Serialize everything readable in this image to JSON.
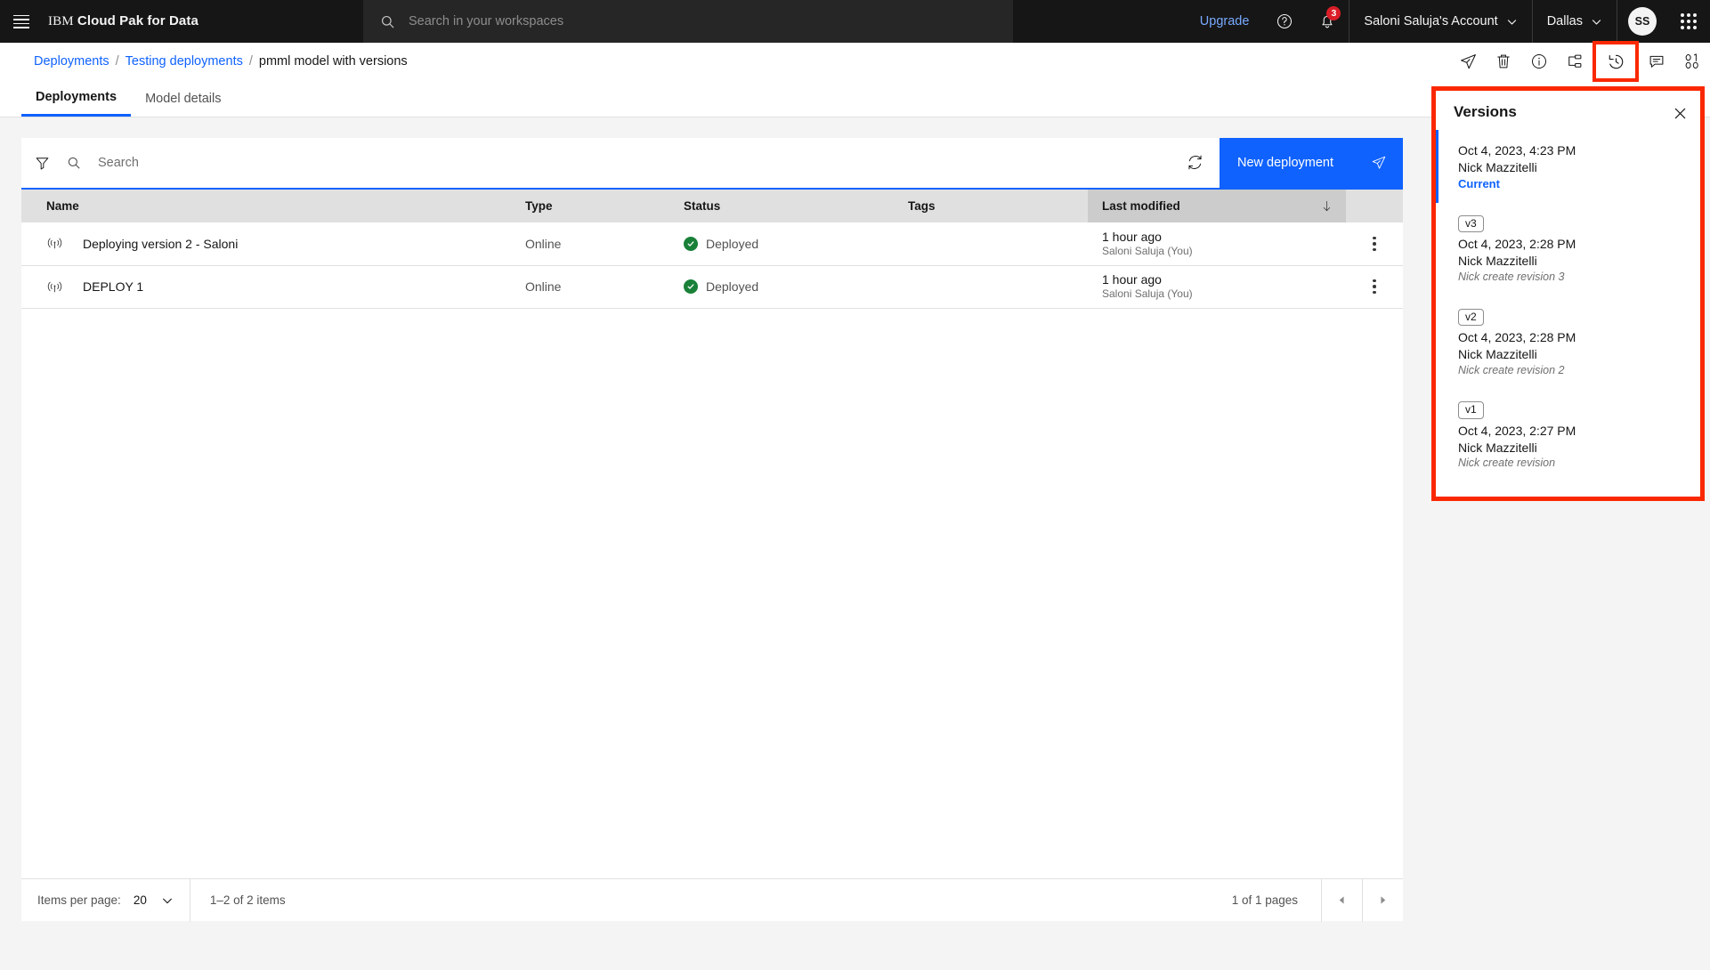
{
  "colors": {
    "brand_blue": "#0f62fe",
    "link_blue": "#78a9ff",
    "header_bg": "#161616",
    "highlight_red": "#fa2800",
    "success_green": "#198038"
  },
  "header": {
    "menu_icon": "hamburger-menu-icon",
    "brand_ibm": "IBM",
    "brand_product": "Cloud Pak for Data",
    "search": {
      "icon": "search-icon",
      "value": "",
      "placeholder": "Search in your workspaces"
    },
    "upgrade_label": "Upgrade",
    "help_icon": "help-circle-icon",
    "notifications_icon": "bell-icon",
    "notifications_count": "3",
    "account_label": "Saloni Saluja's Account",
    "account_chevron": "chevron-down-icon",
    "region_label": "Dallas",
    "region_chevron": "chevron-down-icon",
    "avatar_initials": "SS",
    "app_launcher_icon": "app-grid-icon"
  },
  "breadcrumb": {
    "items": [
      {
        "label": "Deployments",
        "link": true
      },
      {
        "label": "Testing deployments",
        "link": true
      },
      {
        "label": "pmml model with versions",
        "link": false
      }
    ],
    "separator": "/"
  },
  "page_tools": [
    {
      "name": "deploy-icon",
      "title": "Promote"
    },
    {
      "name": "trash-icon",
      "title": "Delete"
    },
    {
      "name": "info-icon",
      "title": "Information"
    },
    {
      "name": "flow-icon",
      "title": "Lineage"
    },
    {
      "name": "history-icon",
      "title": "Versions",
      "highlighted": true
    },
    {
      "name": "comment-icon",
      "title": "Comments"
    },
    {
      "name": "binary-icon",
      "title": "Code"
    }
  ],
  "tabs": [
    {
      "label": "Deployments",
      "active": true
    },
    {
      "label": "Model details",
      "active": false
    }
  ],
  "toolbar": {
    "filter_icon": "filter-icon",
    "search_icon": "search-icon",
    "search_value": "",
    "search_placeholder": "Search",
    "refresh_icon": "refresh-icon",
    "new_deployment_label": "New deployment",
    "new_deployment_icon": "rocket-icon"
  },
  "table": {
    "columns": [
      {
        "label": "Name",
        "sorted": false
      },
      {
        "label": "Type",
        "sorted": false
      },
      {
        "label": "Status",
        "sorted": false
      },
      {
        "label": "Tags",
        "sorted": false
      },
      {
        "label": "Last modified",
        "sorted": true,
        "sort_direction": "descending"
      }
    ],
    "rows": [
      {
        "icon": "broadcast-icon",
        "name": "Deploying version 2 - Saloni",
        "type": "Online",
        "status": "Deployed",
        "status_icon": "check-circle-filled-icon",
        "tags": "",
        "modified_when": "1 hour ago",
        "modified_who": "Saloni Saluja (You)",
        "overflow_icon": "overflow-menu-icon"
      },
      {
        "icon": "broadcast-icon",
        "name": "DEPLOY 1",
        "type": "Online",
        "status": "Deployed",
        "status_icon": "check-circle-filled-icon",
        "tags": "",
        "modified_when": "1 hour ago",
        "modified_who": "Saloni Saluja (You)",
        "overflow_icon": "overflow-menu-icon"
      }
    ]
  },
  "pagination": {
    "items_per_page_label": "Items per page:",
    "items_per_page_value": "20",
    "items_per_page_chevron": "chevron-down-icon",
    "range_label": "1–2 of 2 items",
    "pages_label": "1 of 1 pages",
    "prev_icon": "caret-left-icon",
    "next_icon": "caret-right-icon"
  },
  "versions_panel": {
    "title": "Versions",
    "close_icon": "close-icon",
    "items": [
      {
        "tag": "",
        "date": "Oct 4, 2023, 4:23 PM",
        "author": "Nick Mazzitelli",
        "current_label": "Current",
        "note": "",
        "is_current": true
      },
      {
        "tag": "v3",
        "date": "Oct 4, 2023, 2:28 PM",
        "author": "Nick Mazzitelli",
        "current_label": "",
        "note": "Nick create revision 3",
        "is_current": false
      },
      {
        "tag": "v2",
        "date": "Oct 4, 2023, 2:28 PM",
        "author": "Nick Mazzitelli",
        "current_label": "",
        "note": "Nick create revision 2",
        "is_current": false
      },
      {
        "tag": "v1",
        "date": "Oct 4, 2023, 2:27 PM",
        "author": "Nick Mazzitelli",
        "current_label": "",
        "note": "Nick create revision",
        "is_current": false
      }
    ]
  }
}
